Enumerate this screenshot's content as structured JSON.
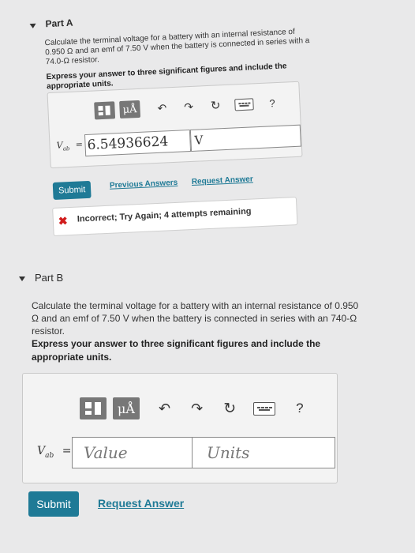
{
  "partA": {
    "title": "Part A",
    "problem_line1": "Calculate the terminal voltage for a battery with an internal resistance of",
    "problem_line2": "0.950  Ω  and an emf of 7.50  V  when the battery is connected in series with a",
    "problem_line3": "74.0-Ω resistor.",
    "instruction_line1": "Express your answer to three significant figures and include the",
    "instruction_line2": "appropriate units.",
    "toolbar": {
      "mu_label": "μÅ",
      "help_label": "?"
    },
    "variable_label": "V",
    "variable_sub": "ab",
    "equals": "=",
    "value": "6.54936624",
    "units": "V",
    "submit_label": "Submit",
    "previous_answers_label": "Previous Answers",
    "request_answer_label": "Request Answer",
    "feedback_text": "Incorrect; Try Again; 4 attempts remaining"
  },
  "partB": {
    "title": "Part B",
    "problem_line1": "Calculate the terminal voltage for a battery with an internal resistance of 0.950",
    "problem_line2": "Ω and an emf of 7.50  V  when the battery is connected in series with an 740-Ω",
    "problem_line3": "resistor.",
    "instruction_line1": "Express your answer to three significant figures and include the",
    "instruction_line2": "appropriate units.",
    "toolbar": {
      "mu_label": "μÅ",
      "help_label": "?"
    },
    "variable_label": "V",
    "variable_sub": "ab",
    "equals": "=",
    "value_placeholder": "Value",
    "units_placeholder": "Units",
    "submit_label": "Submit",
    "request_answer_label": "Request Answer"
  },
  "colors": {
    "accent": "#1f7a96",
    "error": "#d11c1c",
    "toolbar_gray": "#777777"
  }
}
